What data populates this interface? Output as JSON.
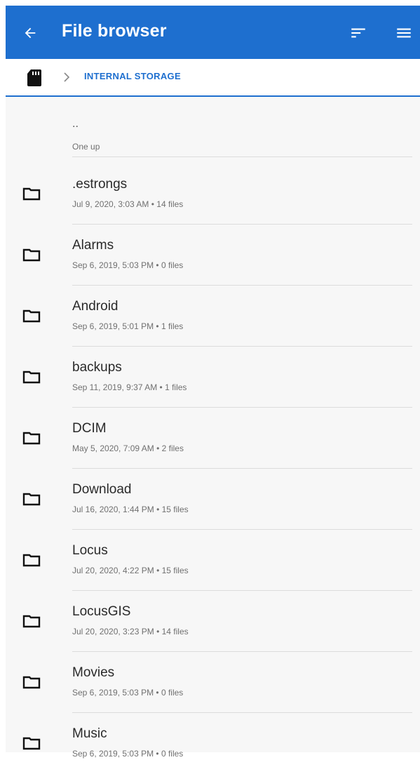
{
  "app_bar": {
    "title": "File browser",
    "back_icon": "arrow-left-icon",
    "sort_icon": "sort-icon",
    "menu_icon": "hamburger-menu-icon",
    "color": "#1e6fcf"
  },
  "breadcrumb": {
    "storage_icon": "sd-card-icon",
    "separator_icon": "chevron-right-icon",
    "label": "INTERNAL STORAGE"
  },
  "up_item": {
    "name": "..",
    "meta": "One up"
  },
  "items": [
    {
      "name": ".estrongs",
      "meta": "Jul 9, 2020, 3:03 AM • 14 files"
    },
    {
      "name": "Alarms",
      "meta": "Sep 6, 2019, 5:03 PM • 0 files"
    },
    {
      "name": "Android",
      "meta": "Sep 6, 2019, 5:01 PM • 1 files"
    },
    {
      "name": "backups",
      "meta": "Sep 11, 2019, 9:37 AM • 1 files"
    },
    {
      "name": "DCIM",
      "meta": "May 5, 2020, 7:09 AM • 2 files"
    },
    {
      "name": "Download",
      "meta": "Jul 16, 2020, 1:44 PM • 15 files"
    },
    {
      "name": "Locus",
      "meta": "Jul 20, 2020, 4:22 PM • 15 files"
    },
    {
      "name": "LocusGIS",
      "meta": "Jul 20, 2020, 3:23 PM • 14 files"
    },
    {
      "name": "Movies",
      "meta": "Sep 6, 2019, 5:03 PM • 0 files"
    },
    {
      "name": "Music",
      "meta": "Sep 6, 2019, 5:03 PM • 0 files"
    }
  ],
  "folder_icon": "folder-icon"
}
